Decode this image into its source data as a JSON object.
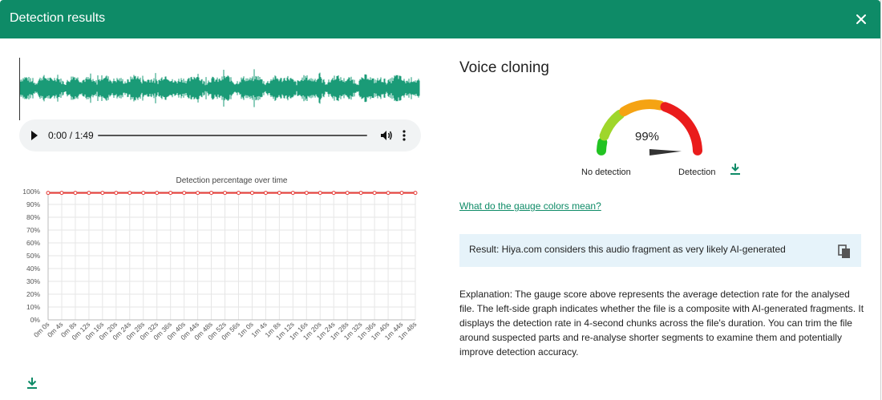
{
  "header": {
    "title": "Detection results",
    "close_icon": "close-icon"
  },
  "player": {
    "time": "0:00 / 1:49",
    "icons": [
      "play-icon",
      "volume-icon",
      "more-vert-icon"
    ]
  },
  "chart_data": {
    "type": "line",
    "title": "Detection percentage over time",
    "x": [
      "0m 0s",
      "0m 4s",
      "0m 8s",
      "0m 12s",
      "0m 16s",
      "0m 20s",
      "0m 24s",
      "0m 28s",
      "0m 32s",
      "0m 36s",
      "0m 40s",
      "0m 44s",
      "0m 48s",
      "0m 52s",
      "0m 56s",
      "1m 0s",
      "1m 4s",
      "1m 8s",
      "1m 12s",
      "1m 16s",
      "1m 20s",
      "1m 24s",
      "1m 28s",
      "1m 32s",
      "1m 36s",
      "1m 40s",
      "1m 44s",
      "1m 48s"
    ],
    "series": [
      {
        "values": [
          99,
          99,
          99,
          99,
          99,
          99,
          99,
          99,
          99,
          99,
          99,
          99,
          99,
          99,
          99,
          99,
          99,
          99,
          99,
          99,
          99,
          99,
          99,
          99,
          99,
          99,
          99,
          99
        ],
        "color": "#e53935"
      }
    ],
    "ylim": [
      0,
      100
    ],
    "yticks": [
      "0%",
      "10%",
      "20%",
      "30%",
      "40%",
      "50%",
      "60%",
      "70%",
      "80%",
      "90%",
      "100%"
    ],
    "grid": true
  },
  "voice": {
    "title": "Voice cloning",
    "gauge_value": 99,
    "gauge_text": "99%",
    "label_left": "No detection",
    "label_right": "Detection",
    "gauge_colors": [
      "#22c322",
      "#9fd62b",
      "#f5a313",
      "#ea1c1c"
    ]
  },
  "link": {
    "text": "What do the gauge colors mean?"
  },
  "result": {
    "text": "Result: Hiya.com considers this audio fragment as very likely AI-generated",
    "icon": "copy-icon"
  },
  "explanation": {
    "text": "Explanation: The gauge score above represents the average detection rate for the analysed file. The left-side graph indicates whether the file is a composite with AI-generated fragments. It displays the detection rate in 4-second chunks across the file's duration. You can trim the file around suspected parts and re-analyse shorter segments to examine them and potentially improve detection accuracy."
  },
  "colors": {
    "accent": "#0e8b67",
    "waveform": "#1a9b77",
    "result_bg": "#e6f3fa"
  }
}
